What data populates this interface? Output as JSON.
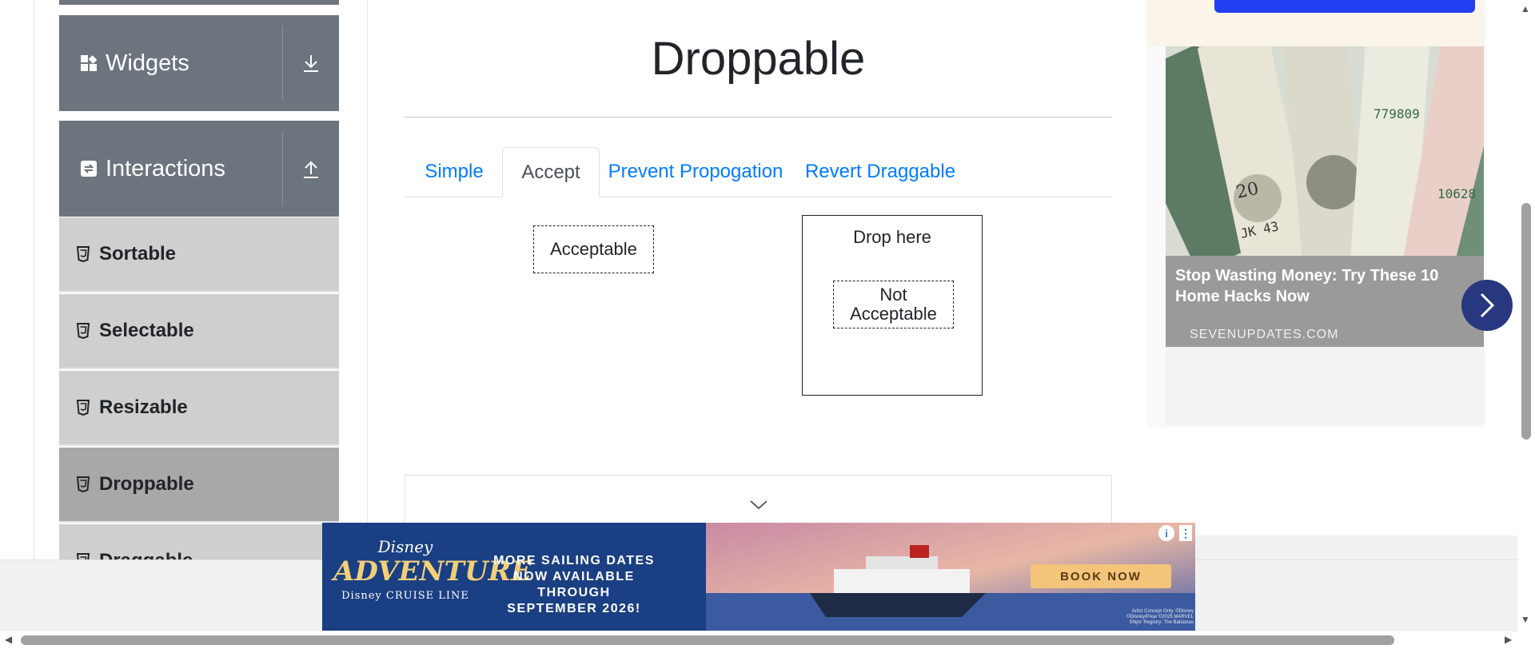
{
  "sidebar": {
    "groups": [
      {
        "label": "Widgets",
        "icon": "widgets-grid-icon",
        "toggle_icon": "download-arrow-icon"
      },
      {
        "label": "Interactions",
        "icon": "interactions-icon",
        "toggle_icon": "upload-arrow-icon"
      }
    ],
    "items": [
      {
        "label": "Sortable",
        "icon": "html5-icon"
      },
      {
        "label": "Selectable",
        "icon": "html5-icon"
      },
      {
        "label": "Resizable",
        "icon": "html5-icon"
      },
      {
        "label": "Droppable",
        "icon": "html5-icon",
        "active": true
      },
      {
        "label": "Draggable",
        "icon": "html5-icon"
      }
    ]
  },
  "main": {
    "title": "Droppable",
    "tabs": [
      {
        "label": "Simple"
      },
      {
        "label": "Accept",
        "active": true
      },
      {
        "label": "Prevent Propogation"
      },
      {
        "label": "Revert Draggable"
      }
    ],
    "acceptable_label": "Acceptable",
    "not_acceptable_label": "Not Acceptable",
    "drop_label": "Drop here"
  },
  "right_ad": {
    "headline": "Stop Wasting Money: Try These 10 Home Hacks Now",
    "source": "SEVENUPDATES.COM"
  },
  "banner": {
    "brand_top": "Disney",
    "brand_main": "ADVENTURE",
    "brand_sub": "Disney CRUISE LINE",
    "message": "MORE SAILING DATES NOW AVAILABLE THROUGH SEPTEMBER 2026!",
    "cta": "BOOK NOW",
    "fine_print": "Artist Concept Only. ©Disney ©Disney/Pixar ©2025 MARVEL Ships' Registry: The Bahamas"
  },
  "colors": {
    "sidebar_group": "#6c757d",
    "sidebar_item": "#cfcfcf",
    "sidebar_item_active": "#a8a8a8",
    "tab_link": "#007bff",
    "ad_arrow": "#273880",
    "banner_cta": "#f3c47a"
  }
}
